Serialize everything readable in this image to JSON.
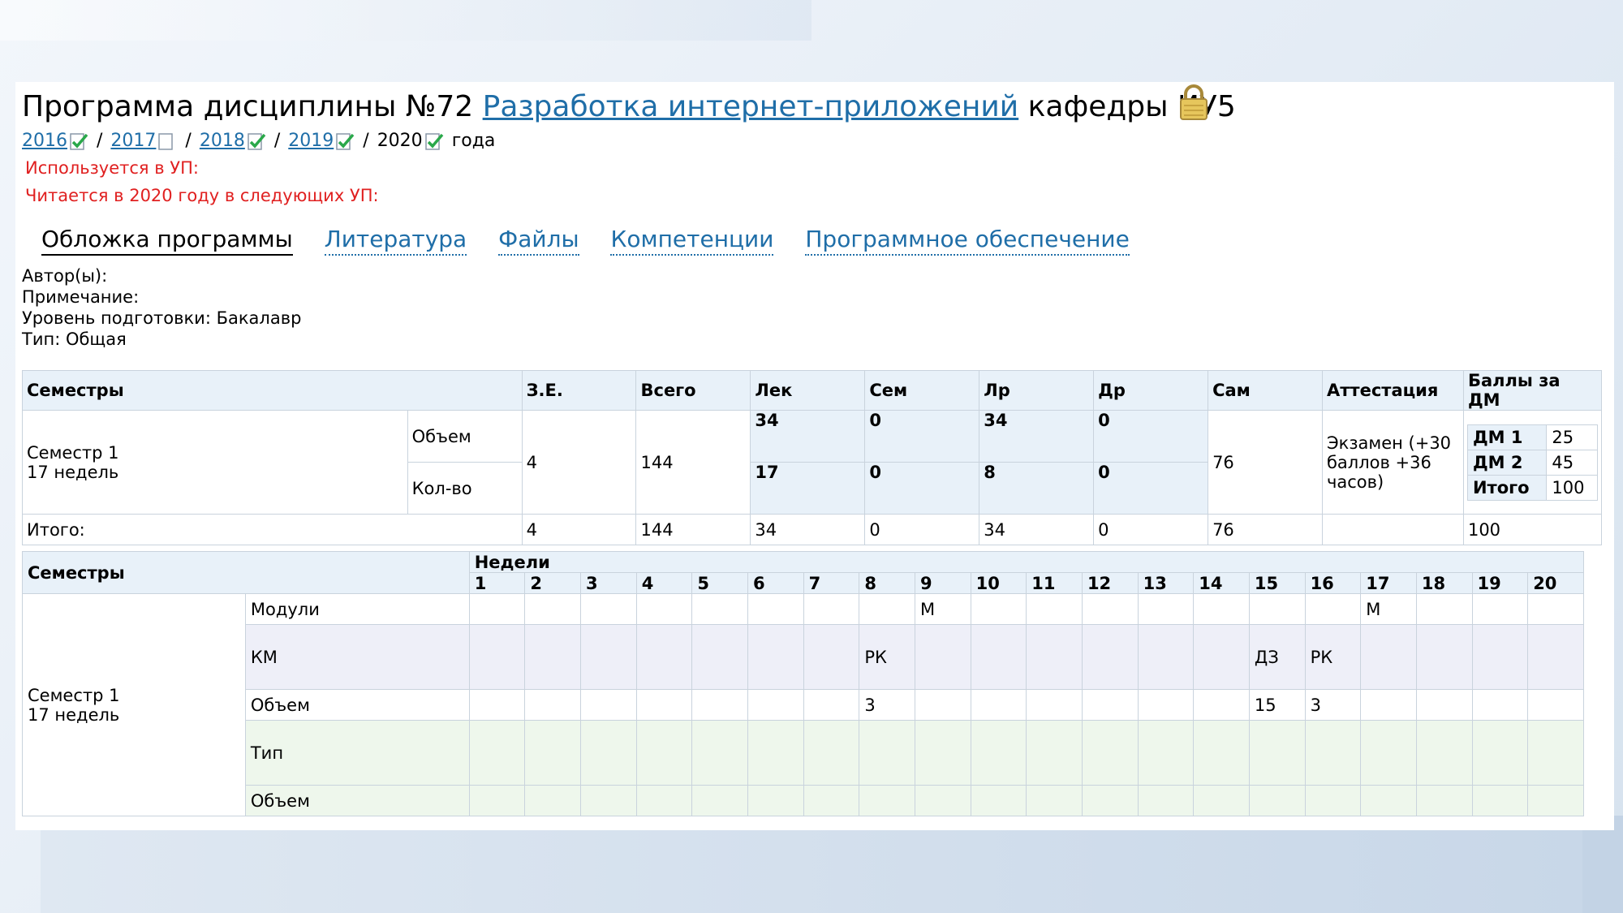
{
  "page": {
    "title_prefix": "Программа дисциплины №72",
    "title_link": "Разработка интернет-приложений",
    "title_suffix": "кафедры ИУ5",
    "lock_icon": "lock-icon",
    "years": [
      {
        "label": "2016",
        "link": true,
        "icon": "check-icon"
      },
      {
        "label": "2017",
        "link": true,
        "icon": "document-icon"
      },
      {
        "label": "2018",
        "link": true,
        "icon": "check-icon"
      },
      {
        "label": "2019",
        "link": true,
        "icon": "check-icon"
      },
      {
        "label": "2020",
        "link": false,
        "icon": "check-icon"
      }
    ],
    "years_sep": "/",
    "years_suffix": "года",
    "used_in": "Используется в УП:",
    "read_in": "Читается в 2020 году в следующих УП:"
  },
  "tabs": [
    "Обложка программы",
    "Литература",
    "Файлы",
    "Компетенции",
    "Программное обеспечение"
  ],
  "info": {
    "authors": "Автор(ы):",
    "note": "Примечание:",
    "level": "Уровень подготовки: Бакалавр",
    "type": "Тип: Общая"
  },
  "summary": {
    "headers": [
      "Семестры",
      "З.Е.",
      "Всего",
      "Лек",
      "Сем",
      "Лр",
      "Др",
      "Сам",
      "Аттестация",
      "Баллы за ДМ"
    ],
    "semester_line1": "Семестр 1",
    "semester_line2": "17 недель",
    "volume_label": "Объем",
    "count_label": "Кол-во",
    "ze": "4",
    "total": "144",
    "volume": {
      "lek": "34",
      "sem": "0",
      "lr": "34",
      "dr": "0"
    },
    "count": {
      "lek": "17",
      "sem": "0",
      "lr": "8",
      "dr": "0"
    },
    "sam": "76",
    "attestation": "Экзамен (+30 баллов +36 часов)",
    "dm": [
      {
        "label": "ДМ 1",
        "value": "25"
      },
      {
        "label": "ДМ 2",
        "value": "45"
      },
      {
        "label": "Итого",
        "value": "100"
      }
    ],
    "totals_label": "Итого:",
    "totals": {
      "ze": "4",
      "total": "144",
      "lek": "34",
      "sem": "0",
      "lr": "34",
      "dr": "0",
      "sam": "76",
      "att": "",
      "points": "100"
    }
  },
  "schedule": {
    "semesters_header": "Семестры",
    "weeks_header": "Недели",
    "weeks": [
      "1",
      "2",
      "3",
      "4",
      "5",
      "6",
      "7",
      "8",
      "9",
      "10",
      "11",
      "12",
      "13",
      "14",
      "15",
      "16",
      "17",
      "18",
      "19",
      "20"
    ],
    "semester_line1": "Семестр 1",
    "semester_line2": "17 недель",
    "rows": [
      {
        "label": "Модули",
        "style": "white",
        "cells": [
          "",
          "",
          "",
          "",
          "",
          "",
          "",
          "",
          "М",
          "",
          "",
          "",
          "",
          "",
          "",
          "",
          "М",
          "",
          "",
          ""
        ]
      },
      {
        "label": "КМ",
        "style": "lav",
        "cells": [
          "",
          "",
          "",
          "",
          "",
          "",
          "",
          "РК",
          "",
          "",
          "",
          "",
          "",
          "",
          "ДЗ",
          "РК",
          "",
          "",
          "",
          ""
        ]
      },
      {
        "label": "Объем",
        "style": "white",
        "cells": [
          "",
          "",
          "",
          "",
          "",
          "",
          "",
          "3",
          "",
          "",
          "",
          "",
          "",
          "",
          "15",
          "3",
          "",
          "",
          "",
          ""
        ]
      },
      {
        "label": "Тип",
        "style": "green",
        "cells": [
          "",
          "",
          "",
          "",
          "",
          "",
          "",
          "",
          "",
          "",
          "",
          "",
          "",
          "",
          "",
          "",
          "",
          "",
          "",
          ""
        ]
      },
      {
        "label": "Объем",
        "style": "green",
        "cells": [
          "",
          "",
          "",
          "",
          "",
          "",
          "",
          "",
          "",
          "",
          "",
          "",
          "",
          "",
          "",
          "",
          "",
          "",
          "",
          ""
        ]
      }
    ]
  }
}
